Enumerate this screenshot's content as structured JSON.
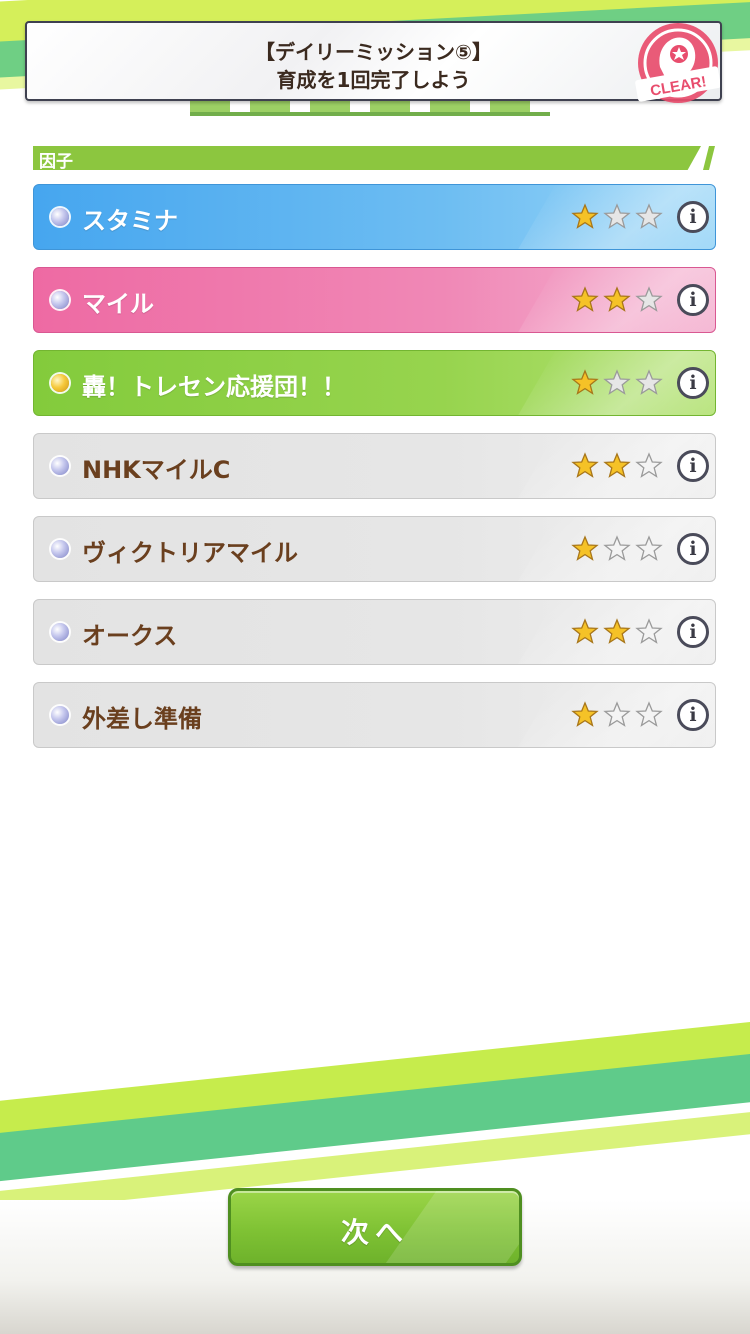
{
  "mission": {
    "line1": "【デイリーミッション⑤】",
    "line2": "育成を1回完了しよう",
    "stamp": "CLEAR!"
  },
  "section": {
    "title": "因子"
  },
  "factors": [
    {
      "name": "スタミナ",
      "color": "blue",
      "dot": "silver",
      "stars": 1,
      "max_stars": 3
    },
    {
      "name": "マイル",
      "color": "pink",
      "dot": "silver",
      "stars": 2,
      "max_stars": 3
    },
    {
      "name": "轟！トレセン応援団！！",
      "color": "green",
      "dot": "gold",
      "stars": 1,
      "max_stars": 3
    },
    {
      "name": "NHKマイルC",
      "color": "gray",
      "dot": "silver",
      "stars": 2,
      "max_stars": 3
    },
    {
      "name": "ヴィクトリアマイル",
      "color": "gray",
      "dot": "silver",
      "stars": 1,
      "max_stars": 3
    },
    {
      "name": "オークス",
      "color": "gray",
      "dot": "silver",
      "stars": 2,
      "max_stars": 3
    },
    {
      "name": "外差し準備",
      "color": "gray",
      "dot": "silver",
      "stars": 1,
      "max_stars": 3
    }
  ],
  "info_icon": "i",
  "next_button": {
    "label": "次へ"
  },
  "colors": {
    "accent_green": "#8cc63f",
    "stamp_red": "#e84d6d",
    "star_gold": "#f5c227"
  }
}
